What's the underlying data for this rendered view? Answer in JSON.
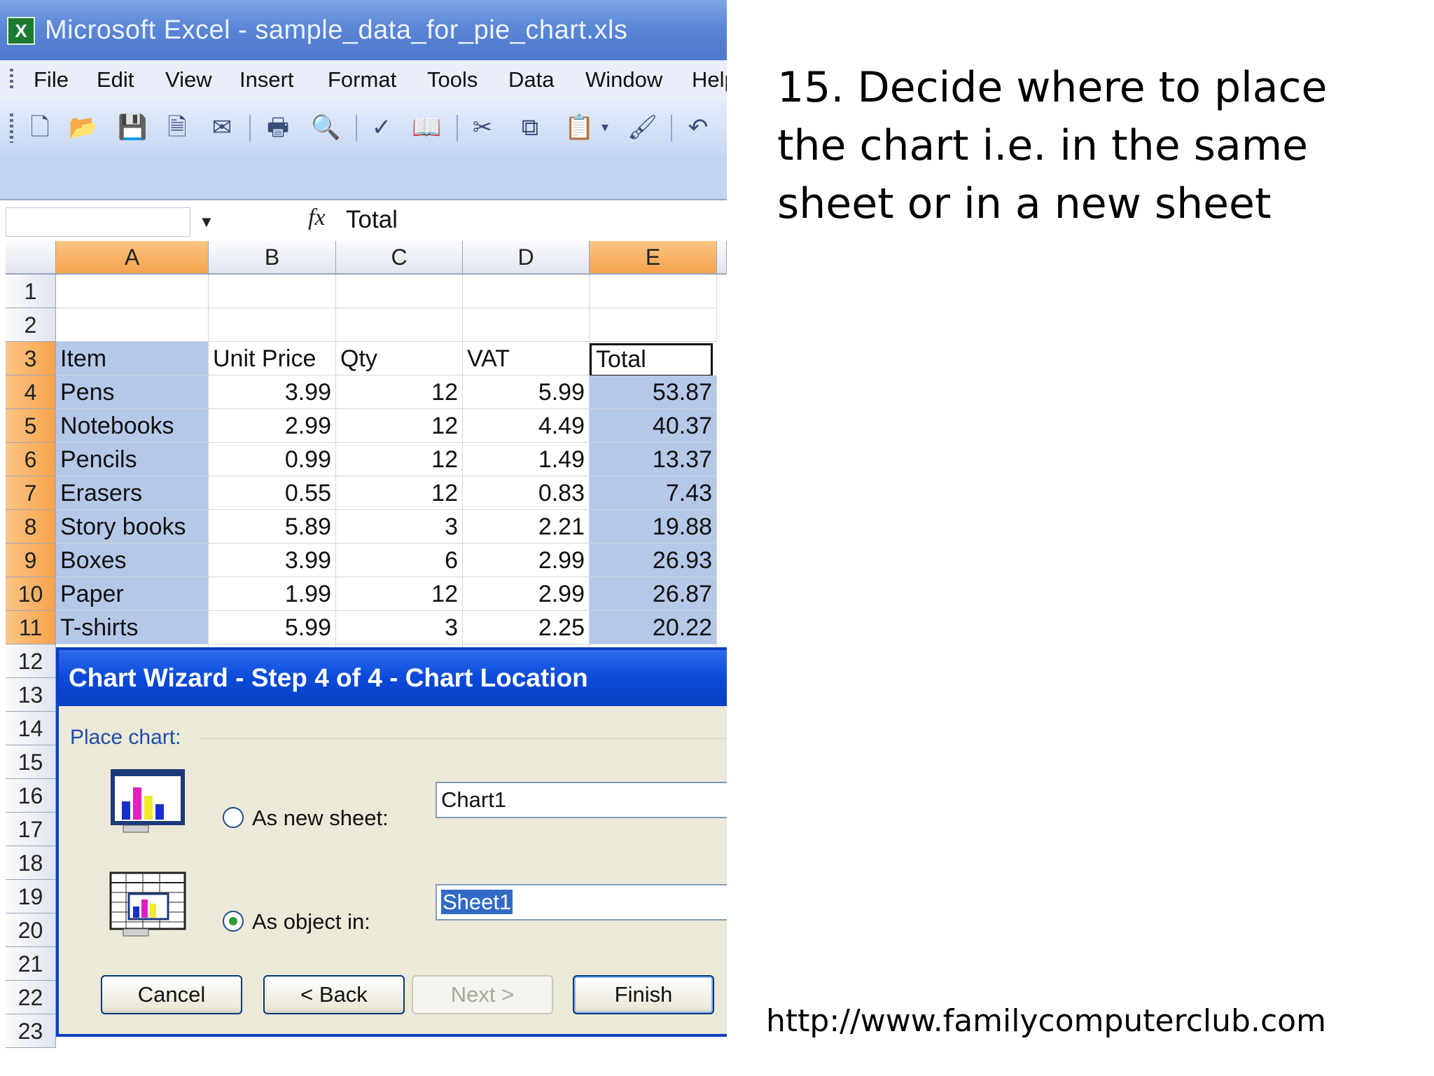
{
  "window": {
    "title": "Microsoft Excel - sample_data_for_pie_chart.xls"
  },
  "menu": [
    "File",
    "Edit",
    "View",
    "Insert",
    "Format",
    "Tools",
    "Data",
    "Window",
    "Help"
  ],
  "formula_bar": {
    "name_box": "",
    "fx_label": "fx",
    "value": "Total"
  },
  "columns": [
    "A",
    "B",
    "C",
    "D",
    "E"
  ],
  "rows": [
    "1",
    "2",
    "3",
    "4",
    "5",
    "6",
    "7",
    "8",
    "9",
    "10",
    "11",
    "12",
    "13",
    "14",
    "15",
    "16",
    "17",
    "18",
    "19",
    "20",
    "21",
    "22",
    "23"
  ],
  "table": {
    "headers": [
      "Item",
      "Unit Price",
      "Qty",
      "VAT",
      "Total"
    ],
    "data": [
      [
        "Pens",
        "3.99",
        "12",
        "5.99",
        "53.87"
      ],
      [
        "Notebooks",
        "2.99",
        "12",
        "4.49",
        "40.37"
      ],
      [
        "Pencils",
        "0.99",
        "12",
        "1.49",
        "13.37"
      ],
      [
        "Erasers",
        "0.55",
        "12",
        "0.83",
        "7.43"
      ],
      [
        "Story books",
        "5.89",
        "3",
        "2.21",
        "19.88"
      ],
      [
        "Boxes",
        "3.99",
        "6",
        "2.99",
        "26.93"
      ],
      [
        "Paper",
        "1.99",
        "12",
        "2.99",
        "26.87"
      ],
      [
        "T-shirts",
        "5.99",
        "3",
        "2.25",
        "20.22"
      ]
    ]
  },
  "dialog": {
    "title": "Chart Wizard - Step 4 of 4 - Chart Location",
    "group_label": "Place chart:",
    "new_sheet_label": "As new sheet:",
    "new_sheet_value": "Chart1",
    "object_label": "As object in:",
    "object_value": "Sheet1",
    "selected_option": "object",
    "buttons": {
      "cancel": "Cancel",
      "back": "< Back",
      "next": "Next >",
      "finish": "Finish"
    }
  },
  "slide": {
    "instruction": "15. Decide where to place the chart i.e. in the same sheet or in a new sheet",
    "url": "http://www.familycomputerclub.com"
  },
  "colors": {
    "title_bar": "#5a86d6",
    "dialog_title": "#0a4ad8",
    "selection": "#b5c8e8",
    "header_selected": "#f5a24c"
  }
}
